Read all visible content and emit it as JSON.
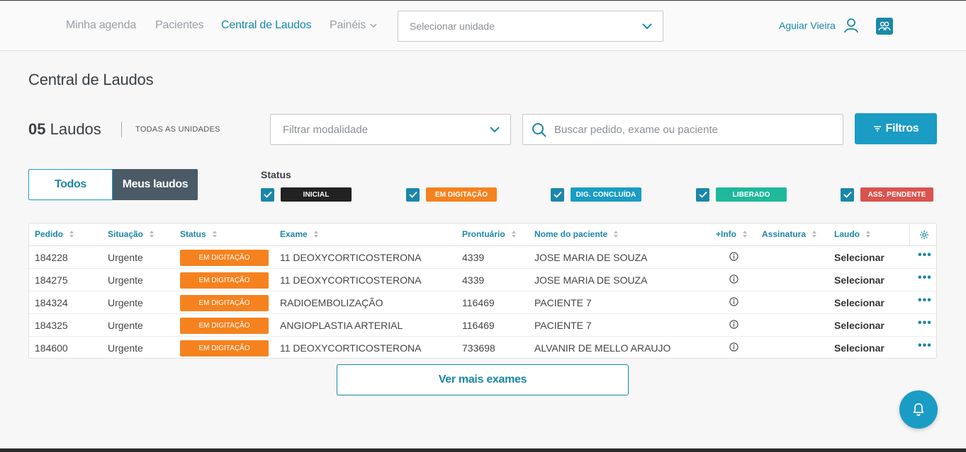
{
  "nav": {
    "items": [
      {
        "label": "Minha agenda"
      },
      {
        "label": "Pacientes"
      },
      {
        "label": "Central de Laudos"
      },
      {
        "label": "Painéis"
      }
    ],
    "unit_placeholder": "Selecionar unidade",
    "user_name": "Aguiar Vieira"
  },
  "page": {
    "title": "Central de Laudos",
    "count_number": "05",
    "count_label": "Laudos",
    "all_units": "TODAS AS UNIDADES",
    "modality_placeholder": "Filtrar modalidade",
    "search_placeholder": "Buscar pedido, exame ou paciente",
    "filters_label": "Filtros"
  },
  "toggle": {
    "todos": "Todos",
    "meus": "Meus laudos"
  },
  "status_filter": {
    "label": "Status",
    "items": [
      {
        "label": "INICIAL",
        "color": "#222222"
      },
      {
        "label": "EM DIGITAÇÃO",
        "color": "#f5821f"
      },
      {
        "label": "DIG. CONCLUÍDA",
        "color": "#1b9cc4"
      },
      {
        "label": "LIBERADO",
        "color": "#1fb89a"
      },
      {
        "label": "ASS. PENDENTE",
        "color": "#d9534f"
      }
    ]
  },
  "table": {
    "headers": [
      "Pedido",
      "Situação",
      "Status",
      "Exame",
      "Prontuário",
      "Nome do paciente",
      "+Info",
      "Assinatura",
      "Laudo"
    ],
    "rows": [
      {
        "pedido": "184228",
        "situacao": "Urgente",
        "status": "EM DIGITAÇÃO",
        "exame": "11 DEOXYCORTICOSTERONA",
        "prontuario": "4339",
        "paciente": "JOSE MARIA DE SOUZA",
        "laudo": "Selecionar"
      },
      {
        "pedido": "184275",
        "situacao": "Urgente",
        "status": "EM DIGITAÇÃO",
        "exame": "11 DEOXYCORTICOSTERONA",
        "prontuario": "4339",
        "paciente": "JOSE MARIA DE SOUZA",
        "laudo": "Selecionar"
      },
      {
        "pedido": "184324",
        "situacao": "Urgente",
        "status": "EM DIGITAÇÃO",
        "exame": "RADIOEMBOLIZAÇÃO",
        "prontuario": "116469",
        "paciente": "PACIENTE 7",
        "laudo": "Selecionar"
      },
      {
        "pedido": "184325",
        "situacao": "Urgente",
        "status": "EM DIGITAÇÃO",
        "exame": "ANGIOPLASTIA ARTERIAL",
        "prontuario": "116469",
        "paciente": "PACIENTE 7",
        "laudo": "Selecionar"
      },
      {
        "pedido": "184600",
        "situacao": "Urgente",
        "status": "EM DIGITAÇÃO",
        "exame": "11 DEOXYCORTICOSTERONA",
        "prontuario": "733698",
        "paciente": "ALVANIR DE MELLO ARAUJO",
        "laudo": "Selecionar"
      }
    ],
    "more_symbol": "•••"
  },
  "more_button": "Ver mais exames",
  "icons": [
    "chevron-down-icon",
    "user-icon",
    "team-icon",
    "search-icon",
    "filter-icon",
    "check-icon",
    "sort-icon",
    "gear-icon",
    "info-icon",
    "more-icon",
    "bell-icon"
  ]
}
